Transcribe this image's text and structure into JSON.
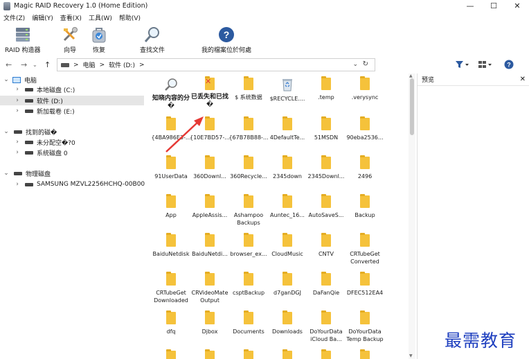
{
  "window": {
    "title": "Magic RAID Recovery 1.0 (Home Edition)",
    "minimize": "—",
    "maximize": "☐",
    "close": "✕"
  },
  "menu": [
    "文件(Z)",
    "编辑(Y)",
    "查看(X)",
    "工具(W)",
    "帮助(V)"
  ],
  "toolbar": {
    "raid_label": "RAID 构造器",
    "wizard_label": "向导",
    "recover_label": "恢复",
    "find_label": "查找文件",
    "help_label": "我的檔案位於何處"
  },
  "address": {
    "segments": [
      "电脑",
      "软件 (D:)"
    ],
    "sep": ">",
    "back": "←",
    "forward": "→",
    "up": "↑",
    "dropdown": "⌄",
    "refresh": "↻"
  },
  "tree": {
    "computer": "电脑",
    "local_c": "本地磁盘 (C:)",
    "soft_d": "软件 (D:)",
    "new_e": "新加载卷 (E:)",
    "found": "找到的磁�",
    "unalloc": "未分配空�?0",
    "sysdisk": "系统磁盘 0",
    "physical": "物理磁盘",
    "samsung": "SAMSUNG MZVL2256HCHQ-00B00"
  },
  "files": [
    [
      "知晓内容的分�",
      "已丢失和已找�",
      "$ 系统数据",
      "$RECYCLE....",
      ".temp",
      ".verysync"
    ],
    [
      "{4BA986E3-...",
      "{10E7BD57-...",
      "{67B78B88-...",
      "4DefaultTe...",
      "51MSDN",
      "90eba2536..."
    ],
    [
      "91UserData",
      "360Downl...",
      "360Recycle...",
      "2345down",
      "2345Downl...",
      "2496"
    ],
    [
      "App",
      "AppleAssis...",
      "Ashampoo Backups",
      "Auntec_16...",
      "AutoSaveS...",
      "Backup"
    ],
    [
      "BaiduNetdisk",
      "BaiduNetdi...",
      "browser_ex...",
      "CloudMusic",
      "CNTV",
      "CRTubeGet Converted"
    ],
    [
      "CRTubeGet Downloaded",
      "CRVideoMate Output",
      "csptBackup",
      "d7ganDGJ",
      "DaFanQie",
      "DFEC512EA4"
    ],
    [
      "dfq",
      "Djbox",
      "Documents",
      "Downloads",
      "DoYourData iCloud Ba...",
      "DoYourData Temp Backup"
    ]
  ],
  "preview": {
    "title": "预览",
    "close": "✕"
  },
  "watermark": "最需教育",
  "colors": {
    "folder": "#f5c23b",
    "help_blue": "#2c5aa0",
    "arrow_red": "#e53935",
    "watermark": "#1e3fbf"
  }
}
